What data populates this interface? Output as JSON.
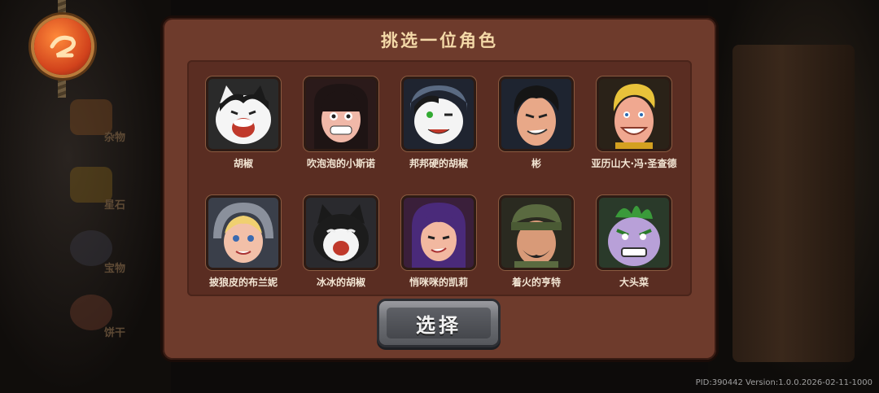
{
  "dialog": {
    "title": "挑选一位角色",
    "select_label": "选择"
  },
  "characters": [
    {
      "name": "胡椒",
      "icon": "white-cat-portrait"
    },
    {
      "name": "吹泡泡的小斯诺",
      "icon": "girl-bangs-portrait"
    },
    {
      "name": "邦邦硬的胡椒",
      "icon": "armored-cat-portrait"
    },
    {
      "name": "彬",
      "icon": "black-hair-man-portrait"
    },
    {
      "name": "亚历山大·冯·圣查德",
      "icon": "blond-man-portrait"
    },
    {
      "name": "披狼皮的布兰妮",
      "icon": "wolf-hood-girl-portrait"
    },
    {
      "name": "冰冰的胡椒",
      "icon": "black-cat-portrait"
    },
    {
      "name": "悄咪咪的凯莉",
      "icon": "purple-hair-girl-portrait"
    },
    {
      "name": "着火的亨特",
      "icon": "soldier-portrait"
    },
    {
      "name": "大头菜",
      "icon": "purple-monster-portrait"
    }
  ],
  "sidebar": {
    "items": [
      {
        "label": "杂物",
        "icon": "food-icon"
      },
      {
        "label": "星石",
        "icon": "star-stone-icon"
      },
      {
        "label": "宝物",
        "icon": "treasure-icon"
      },
      {
        "label": "饼干",
        "icon": "cookie-icon"
      }
    ]
  },
  "footer": {
    "build_info": "PID:390442 Version:1.0.0.2026-02-11-1000"
  },
  "colors": {
    "dialog_bg": "#6e3b2c",
    "panel_bg": "#5a2d22",
    "title_text": "#f4d9a8",
    "button_bg": "#6d6f74"
  }
}
